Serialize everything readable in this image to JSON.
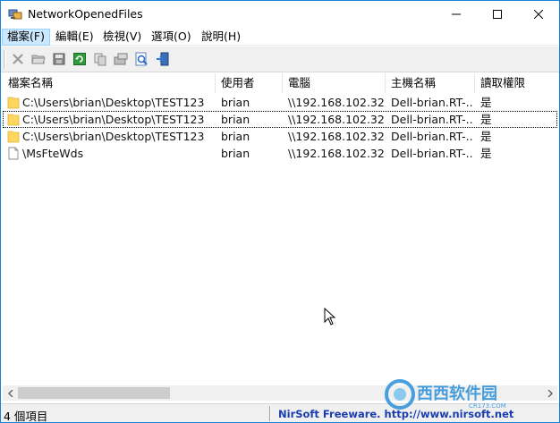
{
  "window": {
    "title": "NetworkOpenedFiles"
  },
  "menu": [
    {
      "label": "檔案(F)",
      "active": true
    },
    {
      "label": "編輯(E)"
    },
    {
      "label": "檢視(V)"
    },
    {
      "label": "選項(O)"
    },
    {
      "label": "說明(H)"
    }
  ],
  "toolbar": {
    "icons": [
      "close-files-icon",
      "open-folder-icon",
      "save-icon",
      "refresh-icon",
      "copy-icon",
      "properties-icon",
      "html-report-icon",
      "exit-icon"
    ]
  },
  "table": {
    "columns": [
      "檔案名稱",
      "使用者",
      "電腦",
      "主機名稱",
      "讀取權限"
    ],
    "rows": [
      {
        "icon": "folder-icon",
        "file": "C:\\Users\\brian\\Desktop\\TEST123",
        "user": "brian",
        "computer": "\\\\192.168.102.32",
        "host": "Dell-brian.RT-...",
        "read": "是"
      },
      {
        "icon": "folder-icon",
        "file": "C:\\Users\\brian\\Desktop\\TEST123",
        "user": "brian",
        "computer": "\\\\192.168.102.32",
        "host": "Dell-brian.RT-...",
        "read": "是",
        "focused": true
      },
      {
        "icon": "folder-icon",
        "file": "C:\\Users\\brian\\Desktop\\TEST123",
        "user": "brian",
        "computer": "\\\\192.168.102.32",
        "host": "Dell-brian.RT-...",
        "read": "是"
      },
      {
        "icon": "file-icon",
        "file": "\\MsFteWds",
        "user": "brian",
        "computer": "\\\\192.168.102.32",
        "host": "Dell-brian.RT-...",
        "read": "是"
      }
    ]
  },
  "status": {
    "count": "4 個項目",
    "link": "NirSoft Freeware.  http://www.nirsoft.net"
  },
  "watermark": {
    "text": "西西软件园",
    "sub": "CR173.COM"
  },
  "colors": {
    "folder": "#ffd75e",
    "border": "#1883d7",
    "link": "#1a3eb0"
  }
}
